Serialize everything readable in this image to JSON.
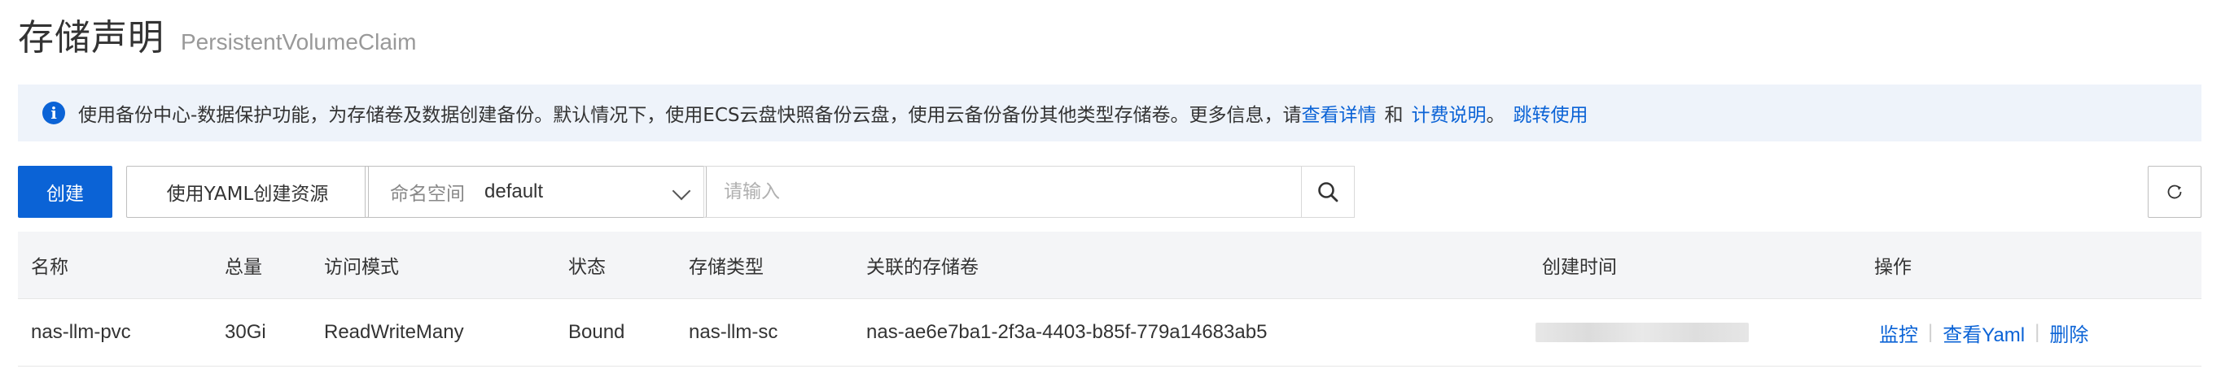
{
  "header": {
    "title": "存储声明",
    "subtitle": "PersistentVolumeClaim"
  },
  "notice": {
    "text": "使用备份中心-数据保护功能，为存储卷及数据创建备份。默认情况下，使用ECS云盘快照备份云盘，使用云备份备份其他类型存储卷。更多信息，请",
    "link1": "查看详情",
    "and": "和",
    "link2": "计费说明",
    "period": "。",
    "link3": "跳转使用"
  },
  "toolbar": {
    "create_label": "创建",
    "yaml_create_label": "使用YAML创建资源",
    "namespace_label": "命名空间",
    "namespace_value": "default",
    "search_placeholder": "请输入"
  },
  "table": {
    "columns": [
      "名称",
      "总量",
      "访问模式",
      "状态",
      "存储类型",
      "关联的存储卷",
      "创建时间",
      "操作"
    ],
    "rows": [
      {
        "name": "nas-llm-pvc",
        "capacity": "30Gi",
        "access_mode": "ReadWriteMany",
        "status": "Bound",
        "storage_class": "nas-llm-sc",
        "volume": "nas-ae6e7ba1-2f3a-4403-b85f-779a14683ab5",
        "actions": [
          "监控",
          "查看Yaml",
          "删除"
        ]
      }
    ]
  },
  "icons": {
    "info": "info-icon",
    "chevron": "chevron-down-icon",
    "search": "search-icon",
    "refresh": "refresh-icon"
  },
  "colors": {
    "primary": "#0b63d6",
    "notice_bg": "#eef3fa",
    "table_header_bg": "#f4f5f7"
  }
}
